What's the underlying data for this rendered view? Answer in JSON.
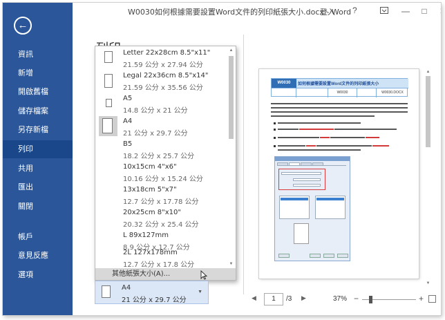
{
  "window": {
    "title": "W0030如何根據需要設置Word文件的列印紙張大小.docx - Word",
    "login": "登入",
    "help": "?",
    "minimize": "—",
    "restore": "□",
    "close": "✕"
  },
  "nav": {
    "back": "←",
    "items": [
      {
        "label": "資訊"
      },
      {
        "label": "新增"
      },
      {
        "label": "開啟舊檔"
      },
      {
        "label": "儲存檔案"
      },
      {
        "label": "另存新檔"
      },
      {
        "label": "列印",
        "active": true
      },
      {
        "label": "共用"
      },
      {
        "label": "匯出"
      },
      {
        "label": "關閉"
      },
      {
        "label": "帳戶"
      },
      {
        "label": "意見反應"
      },
      {
        "label": "選項"
      }
    ]
  },
  "heading": "列印",
  "paper_dropdown": {
    "items": [
      {
        "name": "Letter 22x28cm 8.5\"x11\"",
        "dims": "21.59 公分 x 27.94 公分"
      },
      {
        "name": "Legal 22x36cm 8.5\"x14\"",
        "dims": "21.59 公分 x 35.56 公分"
      },
      {
        "name": "A5",
        "dims": "14.8 公分 x 21 公分"
      },
      {
        "name": "A4",
        "dims": "21 公分 x 29.7 公分",
        "selected": true
      },
      {
        "name": "B5",
        "dims": "18.2 公分 x 25.7 公分"
      },
      {
        "name": "10x15cm 4\"x6\"",
        "dims": "10.16 公分 x 15.24 公分"
      },
      {
        "name": "13x18cm 5\"x7\"",
        "dims": "12.7 公分 x 17.78 公分"
      },
      {
        "name": "20x25cm 8\"x10\"",
        "dims": "20.32 公分 x 25.4 公分"
      },
      {
        "name": "L 89x127mm",
        "dims": "8.9 公分 x 12.7 公分"
      },
      {
        "name": "2L 127x178mm",
        "dims": "12.7 公分 x 17.8 公分"
      }
    ],
    "more": "其他紙張大小(A)..."
  },
  "paper_combo": {
    "name": "A4",
    "dims": "21 公分 x 29.7 公分"
  },
  "pager": {
    "prev": "◀",
    "current": "1",
    "total": "/3",
    "next": "▶"
  },
  "zoom": {
    "percent": "37%",
    "minus": "−",
    "plus": "+"
  },
  "preview_doc": {
    "code": "W0030",
    "title": "如何根據需要設置Word文件的列印紙張大小",
    "row": [
      "W0030",
      "W0030.DOCX"
    ]
  }
}
